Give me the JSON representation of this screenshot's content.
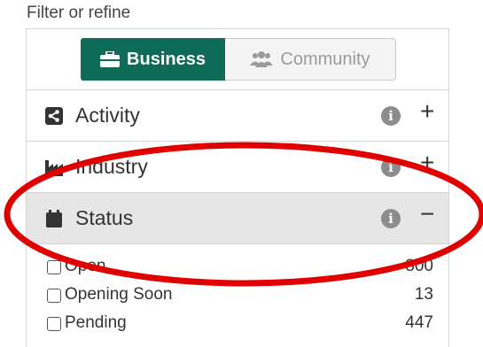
{
  "filter": {
    "heading": "Filter or refine",
    "toggle": {
      "business_label": "Business",
      "community_label": "Community",
      "active": "Business",
      "active_color": "#0e6b57"
    },
    "sections": [
      {
        "label": "Activity",
        "icon": "share-icon",
        "state": "+"
      },
      {
        "label": "Industry",
        "icon": "industry-icon",
        "state": "+"
      },
      {
        "label": "Status",
        "icon": "calendar-icon",
        "state": "−"
      }
    ],
    "info_glyph": "i",
    "status_options": [
      {
        "label": "Open",
        "count": "800",
        "checked": false
      },
      {
        "label": "Opening Soon",
        "count": "13",
        "checked": false
      },
      {
        "label": "Pending",
        "count": "447",
        "checked": false
      }
    ],
    "annotation_color": "#e00000"
  }
}
